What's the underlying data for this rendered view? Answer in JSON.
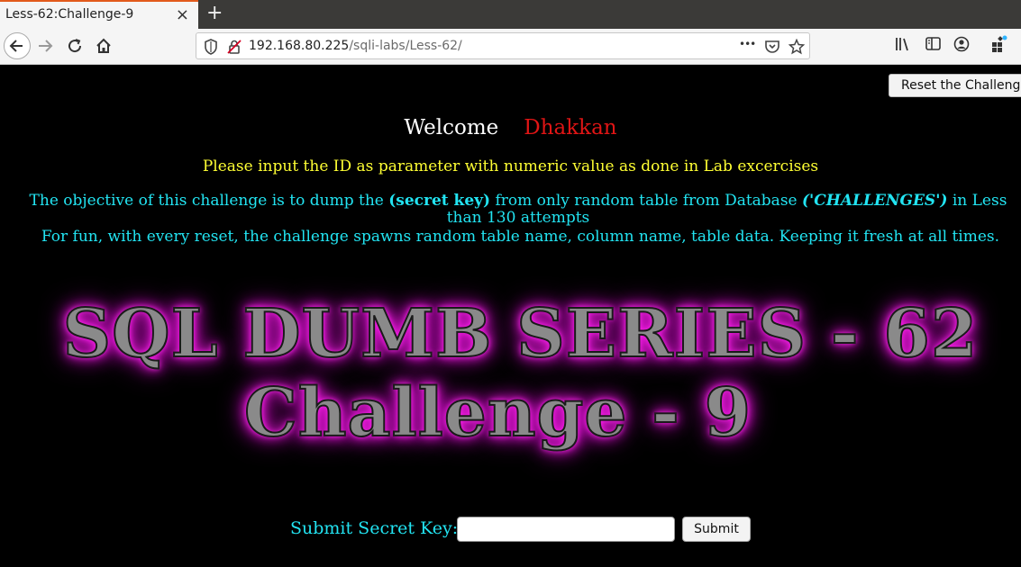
{
  "browser": {
    "tab_title": "Less-62:Challenge-9",
    "close_glyph": "×",
    "new_tab_glyph": "+",
    "url_host": "192.168.80.225",
    "url_path": "/sqli-labs/Less-62/",
    "url_dots": "•••"
  },
  "page": {
    "reset_button": "Reset the Challenge!",
    "welcome_label": "Welcome",
    "welcome_name": "Dhakkan",
    "instruction": "Please input the ID as parameter with numeric value as done in Lab excercises",
    "objective_pre": "The objective of this challenge is to dump the ",
    "objective_secret": "(secret key)",
    "objective_mid": " from only random table from Database ",
    "objective_db": "('CHALLENGES')",
    "objective_post": " in Less than 130 attempts",
    "fun_line": "For fun, with every reset, the challenge spawns random table name, column name, table data. Keeping it fresh at all times.",
    "banner_line1": "SQL DUMB SERIES - 62",
    "banner_line2": "Challenge - 9",
    "submit_label": "Submit Secret Key:",
    "secret_key_value": "",
    "submit_button": "Submit"
  },
  "colors": {
    "welcome_name": "#e01515",
    "instruction": "#ffff33",
    "objective": "#22e4f2",
    "banner_glow": "#ff22ee"
  }
}
